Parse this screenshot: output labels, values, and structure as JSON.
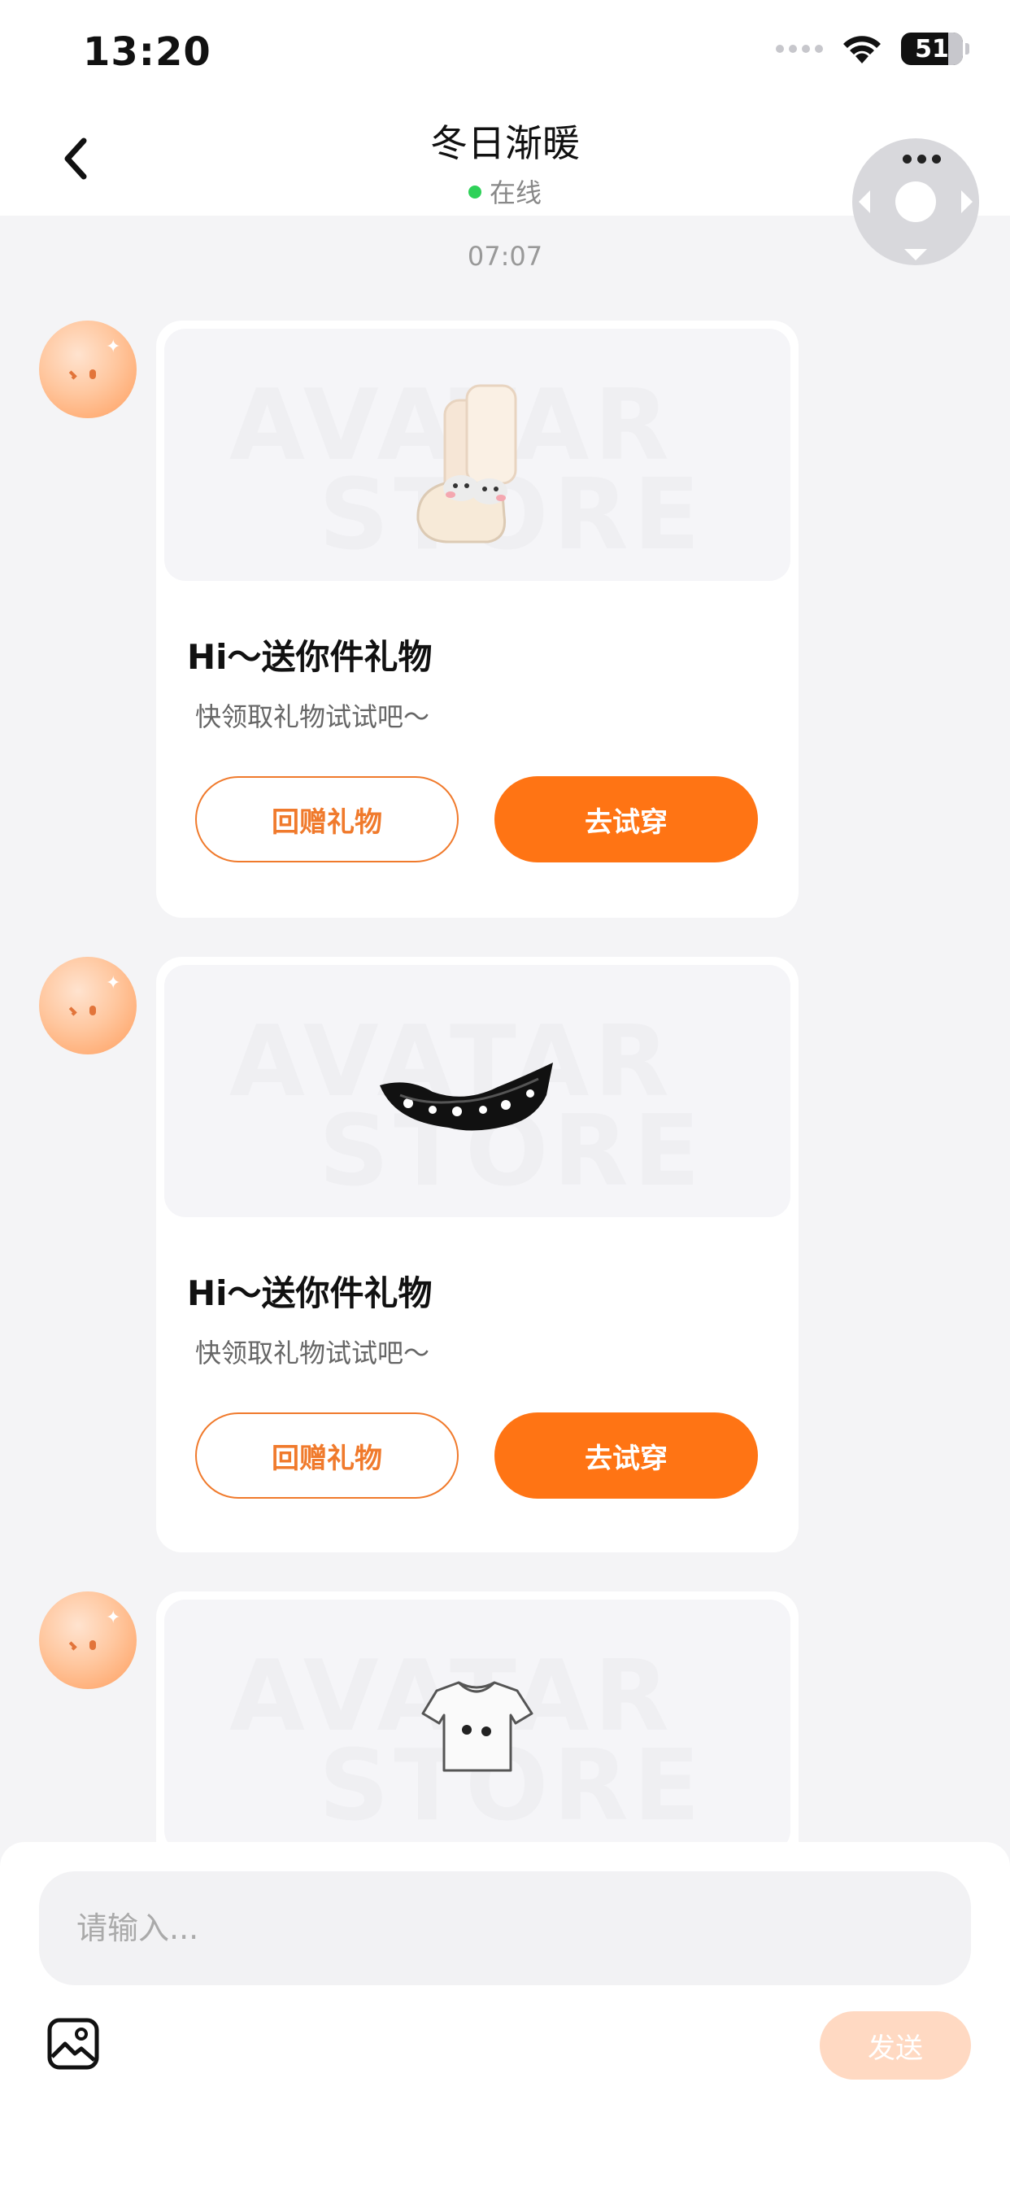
{
  "status_bar": {
    "time": "13:20",
    "battery": "51"
  },
  "header": {
    "title": "冬日渐暖",
    "status": "在线"
  },
  "chat": {
    "timestamp": "07:07",
    "messages": [
      {
        "title": "Hi～送你件礼物",
        "subtitle": "快领取礼物试试吧～",
        "return_label": "回赠礼物",
        "try_label": "去试穿",
        "item_icon": "socks-icon"
      },
      {
        "title": "Hi～送你件礼物",
        "subtitle": "快领取礼物试试吧～",
        "return_label": "回赠礼物",
        "try_label": "去试穿",
        "item_icon": "lace-mask-icon"
      },
      {
        "title": "",
        "subtitle": "",
        "item_icon": "tshirt-icon"
      }
    ],
    "watermark": [
      "AVATAR",
      "STORE"
    ]
  },
  "composer": {
    "placeholder": "请输入...",
    "send_label": "发送"
  },
  "colors": {
    "accent": "#ff7414",
    "online": "#2ed158",
    "send_disabled": "#ffd9c2"
  }
}
